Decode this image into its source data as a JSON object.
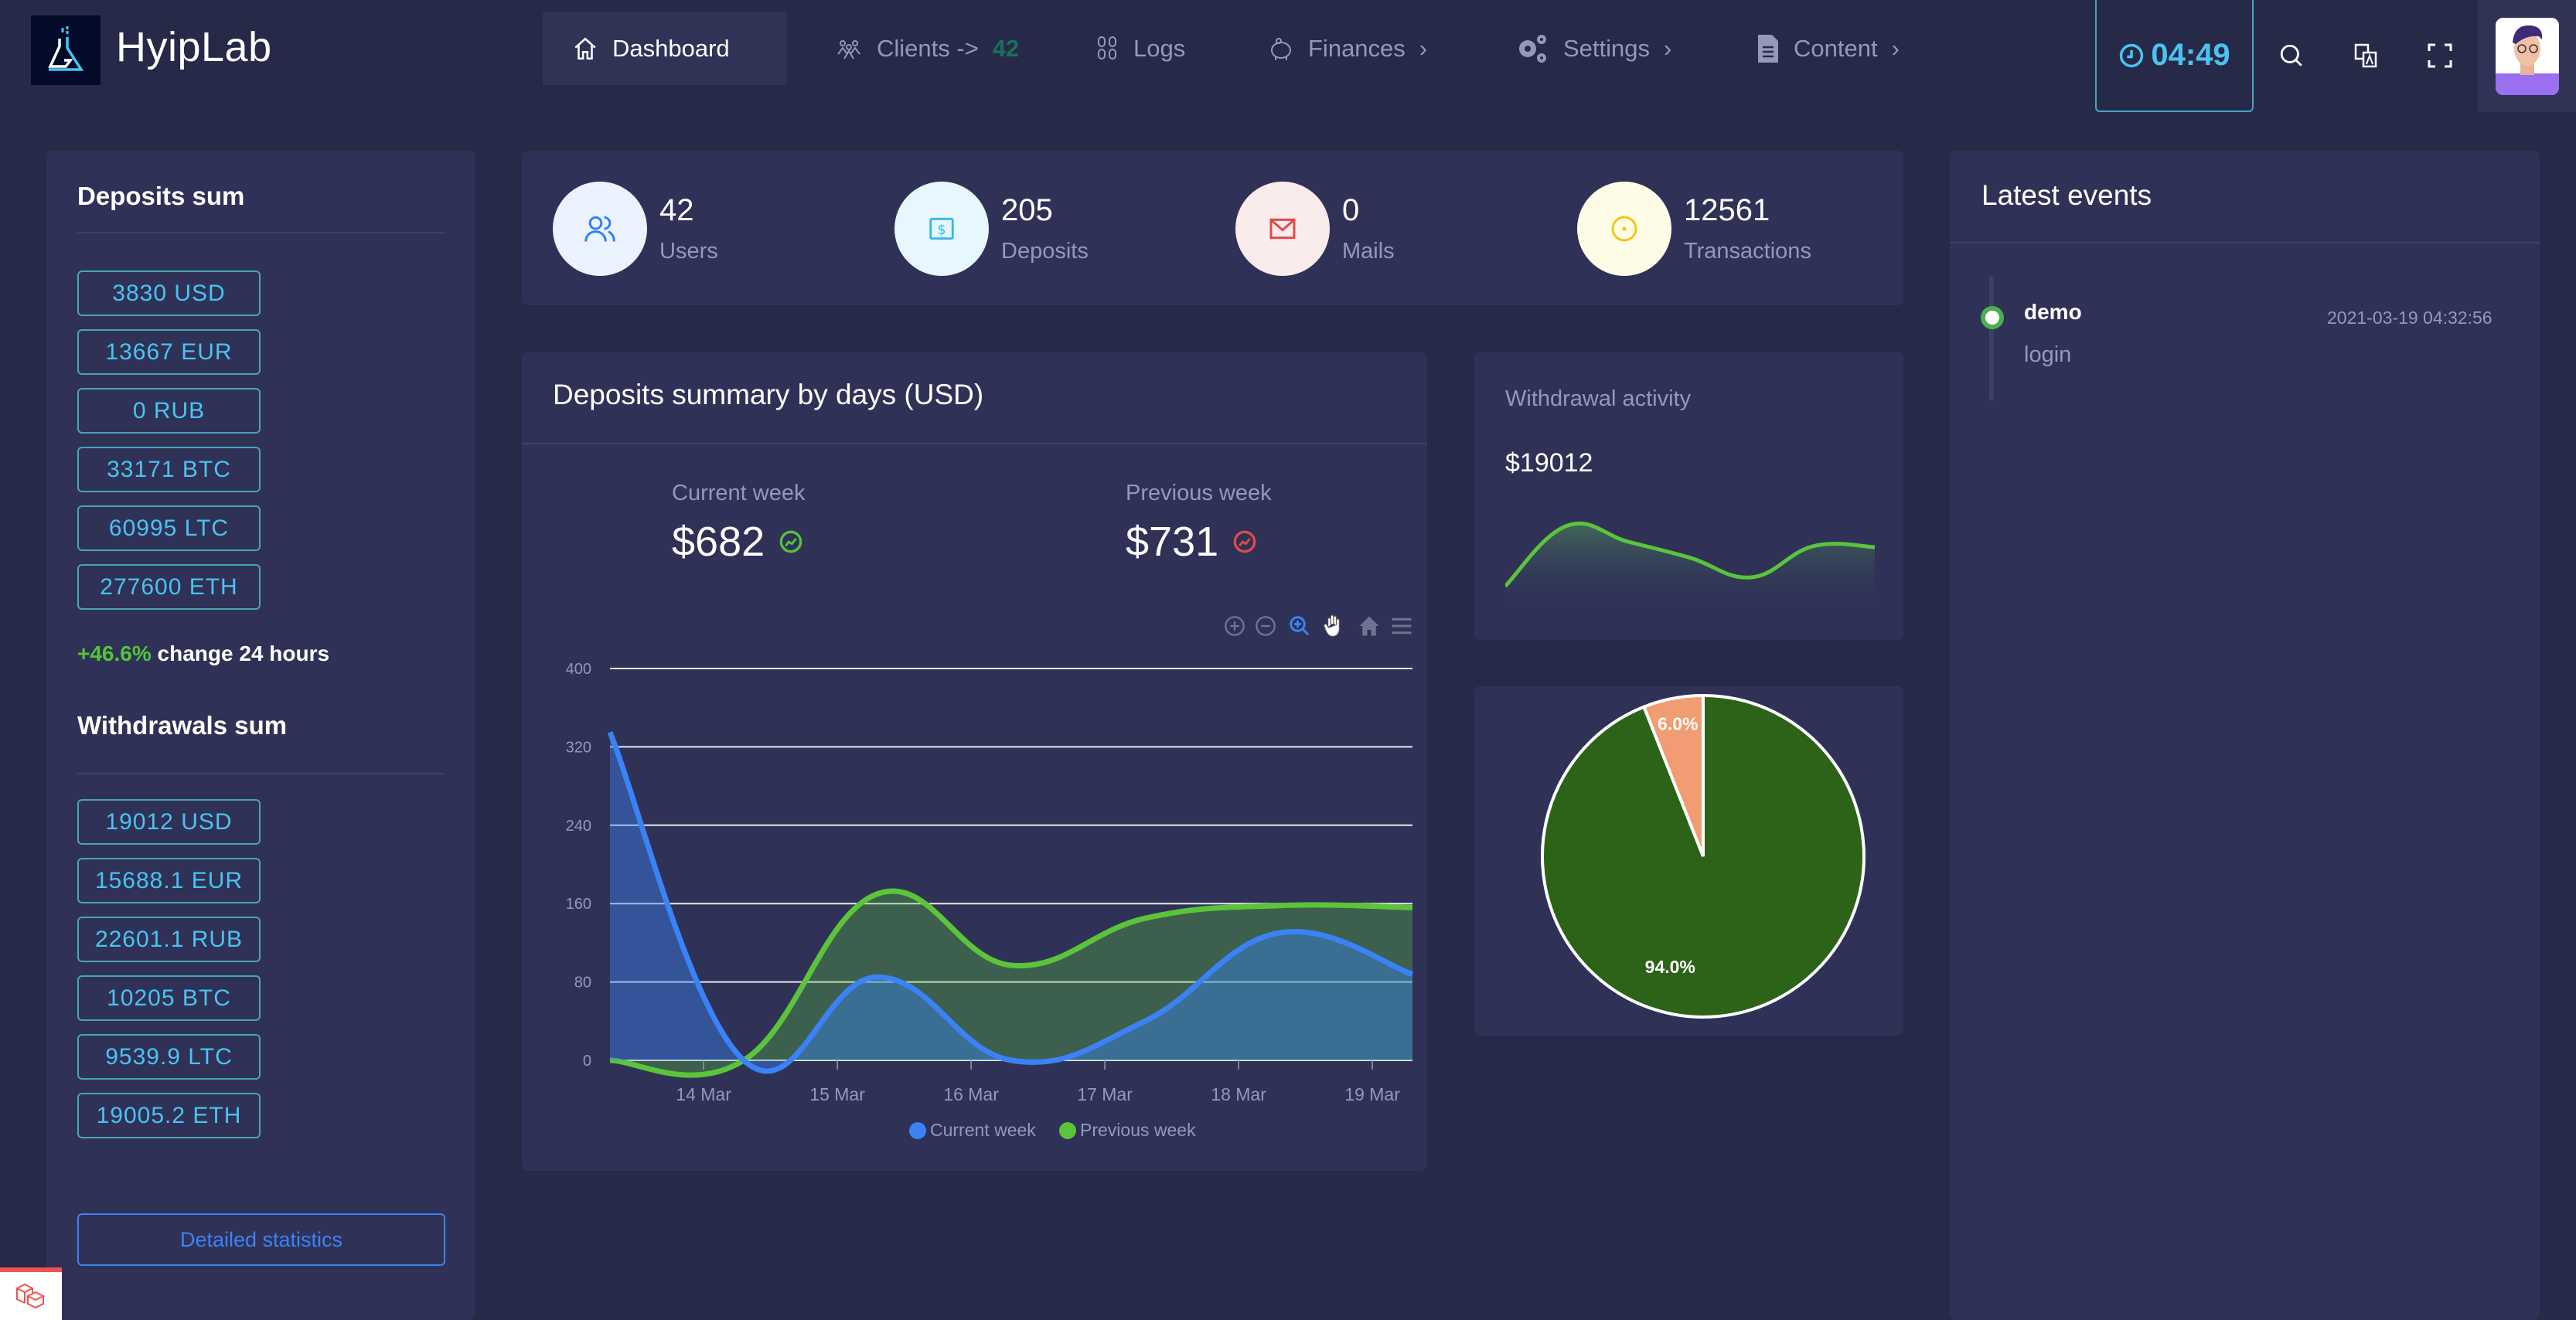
{
  "header": {
    "logo_text": "HyipLab",
    "nav": [
      {
        "label": "Dashboard",
        "icon": "home-icon",
        "active": true
      },
      {
        "label": "Clients ->",
        "badge": "42",
        "icon": "users-icon"
      },
      {
        "label": "Logs",
        "icon": "logs-icon"
      },
      {
        "label": "Finances",
        "chevron": "›",
        "icon": "piggy-bank-icon"
      },
      {
        "label": "Settings",
        "chevron": "›",
        "icon": "gears-icon"
      },
      {
        "label": "Content",
        "chevron": "›",
        "icon": "document-icon"
      }
    ],
    "timer": "04:49"
  },
  "left_panel": {
    "deposits_title": "Deposits sum",
    "deposits": [
      "3830 USD",
      "13667 EUR",
      "0 RUB",
      "33171 BTC",
      "60995 LTC",
      "277600 ETH"
    ],
    "change_value": "+46.6%",
    "change_label": "change 24 hours",
    "withdrawals_title": "Withdrawals sum",
    "withdrawals": [
      "19012 USD",
      "15688.1 EUR",
      "22601.1 RUB",
      "10205 BTC",
      "9539.9 LTC",
      "19005.2 ETH"
    ],
    "detail_button": "Detailed statistics"
  },
  "stats": [
    {
      "value": "42",
      "label": "Users",
      "color": "#2f7ff0",
      "bg": "#eaf3ff"
    },
    {
      "value": "205",
      "label": "Deposits",
      "color": "#38b6e8",
      "bg": "#e6f8fd"
    },
    {
      "value": "0",
      "label": "Mails",
      "color": "#e04a4a",
      "bg": "#fbecec"
    },
    {
      "value": "12561",
      "label": "Transactions",
      "color": "#f5c518",
      "bg": "#fefce6"
    }
  ],
  "deposits_chart_card": {
    "title": "Deposits summary by days (USD)",
    "current_week_label": "Current week",
    "current_week_value": "$682",
    "previous_week_label": "Previous week",
    "previous_week_value": "$731"
  },
  "withdrawal_activity": {
    "title": "Withdrawal activity",
    "value": "$19012",
    "sparkline": [
      10,
      78,
      60,
      42,
      20,
      55,
      54
    ]
  },
  "latest_events": {
    "title": "Latest events",
    "items": [
      {
        "user": "demo",
        "action": "login",
        "time": "2021-03-19 04:32:56"
      }
    ]
  },
  "chart_data": [
    {
      "type": "area",
      "title": "Deposits summary by days (USD)",
      "xlabel": "",
      "ylabel": "",
      "x_ticks": [
        "14 Mar",
        "15 Mar",
        "16 Mar",
        "17 Mar",
        "18 Mar",
        "19 Mar"
      ],
      "x_points": [
        13.3,
        14.3,
        15.3,
        16.3,
        17.3,
        18.3,
        19.3
      ],
      "y_ticks": [
        0,
        80,
        160,
        240,
        320,
        400
      ],
      "ylim": [
        0,
        400
      ],
      "grid": true,
      "legend": "bottom",
      "series": [
        {
          "name": "Current week",
          "color": "#3b82f6",
          "values": [
            335,
            0,
            85,
            0,
            40,
            130,
            88
          ]
        },
        {
          "name": "Previous week",
          "color": "#5bc43a",
          "values": [
            0,
            0,
            170,
            97,
            145,
            158,
            156
          ]
        }
      ]
    },
    {
      "type": "pie",
      "title": "",
      "legend": "none",
      "slices": [
        {
          "label": "94.0%",
          "value": 94.0,
          "color": "#2c6318"
        },
        {
          "label": "6.0%",
          "value": 6.0,
          "color": "#f19c72"
        }
      ]
    }
  ]
}
